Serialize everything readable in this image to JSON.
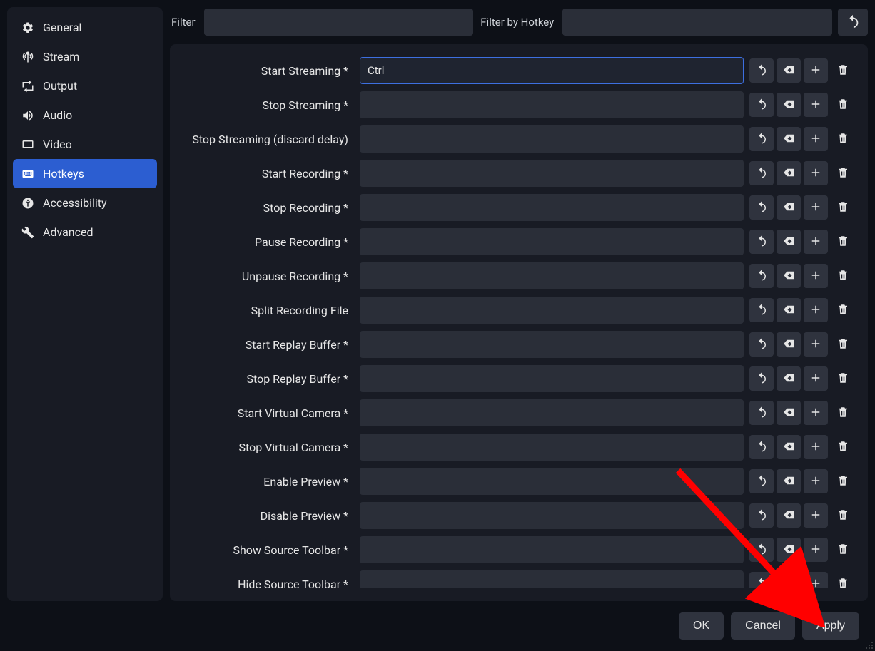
{
  "sidebar": {
    "items": [
      {
        "id": "general",
        "label": "General"
      },
      {
        "id": "stream",
        "label": "Stream"
      },
      {
        "id": "output",
        "label": "Output"
      },
      {
        "id": "audio",
        "label": "Audio"
      },
      {
        "id": "video",
        "label": "Video"
      },
      {
        "id": "hotkeys",
        "label": "Hotkeys"
      },
      {
        "id": "accessibility",
        "label": "Accessibility"
      },
      {
        "id": "advanced",
        "label": "Advanced"
      }
    ],
    "active": "hotkeys"
  },
  "filter": {
    "label": "Filter",
    "hotkey_label": "Filter by Hotkey"
  },
  "hotkeys": [
    {
      "label": "Start Streaming *",
      "value": "Ctrl",
      "active": true
    },
    {
      "label": "Stop Streaming *",
      "value": ""
    },
    {
      "label": "Stop Streaming (discard delay)",
      "value": ""
    },
    {
      "label": "Start Recording *",
      "value": ""
    },
    {
      "label": "Stop Recording *",
      "value": ""
    },
    {
      "label": "Pause Recording *",
      "value": ""
    },
    {
      "label": "Unpause Recording *",
      "value": ""
    },
    {
      "label": "Split Recording File",
      "value": ""
    },
    {
      "label": "Start Replay Buffer *",
      "value": ""
    },
    {
      "label": "Stop Replay Buffer *",
      "value": ""
    },
    {
      "label": "Start Virtual Camera *",
      "value": ""
    },
    {
      "label": "Stop Virtual Camera *",
      "value": ""
    },
    {
      "label": "Enable Preview *",
      "value": ""
    },
    {
      "label": "Disable Preview *",
      "value": ""
    },
    {
      "label": "Show Source Toolbar *",
      "value": ""
    },
    {
      "label": "Hide Source Toolbar *",
      "value": ""
    }
  ],
  "footer": {
    "ok": "OK",
    "cancel": "Cancel",
    "apply": "Apply"
  }
}
